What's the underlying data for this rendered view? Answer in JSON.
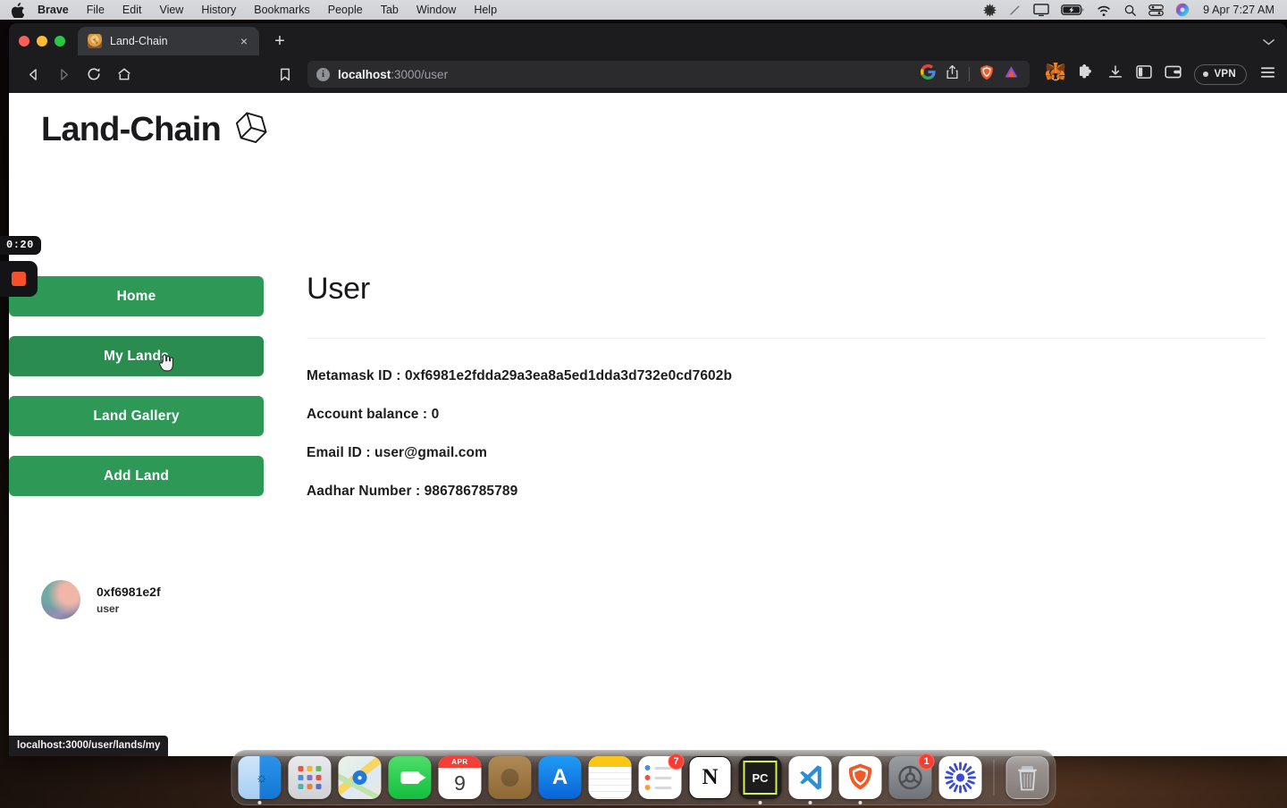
{
  "menubar": {
    "apple_icon": "apple-logo-icon",
    "items": [
      {
        "label": "Brave",
        "bold": true
      },
      {
        "label": "File",
        "bold": false
      },
      {
        "label": "Edit",
        "bold": false
      },
      {
        "label": "View",
        "bold": false
      },
      {
        "label": "History",
        "bold": false
      },
      {
        "label": "Bookmarks",
        "bold": false
      },
      {
        "label": "People",
        "bold": false
      },
      {
        "label": "Tab",
        "bold": false
      },
      {
        "label": "Window",
        "bold": false
      },
      {
        "label": "Help",
        "bold": false
      }
    ],
    "status_icons": [
      "gear-icon",
      "scissors-slash-icon",
      "display-icon",
      "battery-charging-icon",
      "wifi-icon",
      "search-icon",
      "control-center-icon",
      "siri-icon"
    ],
    "clock": "9 Apr  7:27 AM"
  },
  "browser": {
    "tab": {
      "title": "Land-Chain",
      "favicon": "land-chain-favicon",
      "close_label": "×"
    },
    "new_tab_label": "+",
    "tabstrip_caret": "⌄",
    "nav": {
      "back_icon": "back-arrow-icon",
      "forward_icon": "forward-arrow-icon",
      "reload_icon": "reload-icon",
      "home_icon": "home-icon",
      "bookmark_icon": "bookmark-icon"
    },
    "url": {
      "host": "localhost",
      "path": ":3000/user",
      "full": "localhost:3000/user",
      "info_icon": "info-icon",
      "inline_icons": [
        "google-lens-icon",
        "share-icon",
        "brave-shields-icon",
        "brave-rewards-icon"
      ]
    },
    "toolbar_icons": [
      "metamask-fox-icon",
      "extensions-puzzle-icon",
      "downloads-icon",
      "sidebar-panel-icon",
      "brave-wallet-icon"
    ],
    "vpn_label": "VPN",
    "menu_icon": "hamburger-menu-icon"
  },
  "page": {
    "logo": {
      "text": "Land-Chain",
      "icon": "cube-3d-icon"
    },
    "sidebar": {
      "items": [
        {
          "label": "Home",
          "hovered": false
        },
        {
          "label": "My Lands",
          "hovered": true
        },
        {
          "label": "Land Gallery",
          "hovered": false
        },
        {
          "label": "Add Land",
          "hovered": false
        }
      ],
      "cursor_icon": "pointing-hand-cursor-icon"
    },
    "profile": {
      "avatar": "gradient-avatar",
      "name": "0xf6981e2f",
      "role": "user"
    },
    "title": "User",
    "fields": [
      {
        "label": "Metamask ID",
        "value": "0xf6981e2fdda29a3ea8a5ed1dda3d732e0cd7602b",
        "text": "Metamask ID : 0xf6981e2fdda29a3ea8a5ed1dda3d732e0cd7602b"
      },
      {
        "label": "Account balance",
        "value": "0",
        "text": "Account balance : 0"
      },
      {
        "label": "Email ID",
        "value": "user@gmail.com",
        "text": "Email ID : user@gmail.com"
      },
      {
        "label": "Aadhar Number",
        "value": "986786785789",
        "text": "Aadhar Number : 986786785789"
      }
    ],
    "status_bubble": "localhost:3000/user/lands/my"
  },
  "recording": {
    "timer": "0:20",
    "stop_icon": "stop-square-icon"
  },
  "dock": {
    "items": [
      {
        "name": "finder",
        "label": "Finder",
        "running": true,
        "badge": null
      },
      {
        "name": "launchpad",
        "label": "Launchpad",
        "running": false,
        "badge": null
      },
      {
        "name": "maps",
        "label": "Maps",
        "running": false,
        "badge": null
      },
      {
        "name": "facetime",
        "label": "FaceTime",
        "running": false,
        "badge": null
      },
      {
        "name": "calendar",
        "label": "Calendar",
        "running": false,
        "badge": null,
        "month": "APR",
        "day": "9"
      },
      {
        "name": "contacts",
        "label": "Contacts",
        "running": false,
        "badge": null
      },
      {
        "name": "app-store",
        "label": "App Store",
        "running": false,
        "badge": null
      },
      {
        "name": "notes",
        "label": "Notes",
        "running": false,
        "badge": null
      },
      {
        "name": "reminders",
        "label": "Reminders",
        "running": false,
        "badge": "7"
      },
      {
        "name": "notion",
        "label": "Notion",
        "running": false,
        "badge": null,
        "glyph": "N"
      },
      {
        "name": "pycharm",
        "label": "PyCharm",
        "running": true,
        "badge": null,
        "glyph": "PC"
      },
      {
        "name": "vscode",
        "label": "Visual Studio Code",
        "running": true,
        "badge": null
      },
      {
        "name": "brave",
        "label": "Brave Browser",
        "running": true,
        "badge": null
      },
      {
        "name": "system-settings",
        "label": "System Settings",
        "running": false,
        "badge": "1"
      },
      {
        "name": "zotero",
        "label": "Zotero",
        "running": false,
        "badge": null
      },
      {
        "name": "trash",
        "label": "Trash",
        "running": false,
        "badge": null
      }
    ]
  },
  "colors": {
    "brand_green": "#2e9957",
    "brand_green_hover": "#2b8c50",
    "page_bg": "#ffffff",
    "text_dark": "#1d1d1f",
    "browser_chrome": "#1c1c1e",
    "tab_active": "#35363a",
    "badge_red": "#ff3b30",
    "rec_stop_red": "#f6502a"
  }
}
